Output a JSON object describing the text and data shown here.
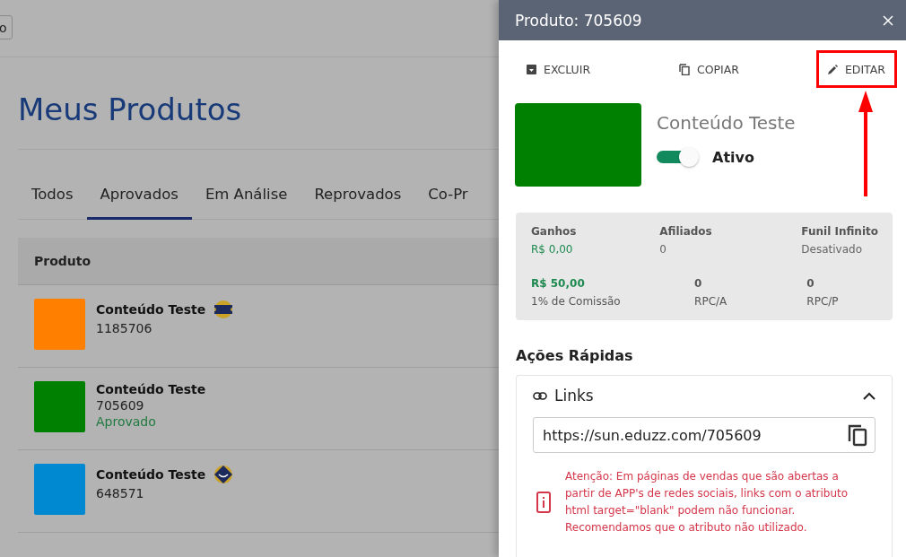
{
  "top_button": {
    "label": "o"
  },
  "page_title": "Meus Produtos",
  "tabs": [
    {
      "label": "Todos",
      "selected": false
    },
    {
      "label": "Aprovados",
      "selected": true
    },
    {
      "label": "Em Análise",
      "selected": false
    },
    {
      "label": "Reprovados",
      "selected": false
    },
    {
      "label": "Co-Pr",
      "selected": false
    }
  ],
  "table": {
    "columns": [
      "Produto"
    ],
    "rows": [
      {
        "name": "Conteúdo Teste",
        "code": "1185706",
        "color": "#ff8000",
        "kind": "ticket"
      },
      {
        "name": "Conteúdo Teste",
        "code": "705609",
        "status": "Aprovado",
        "color": "#008000",
        "kind": "plain"
      },
      {
        "name": "Conteúdo Teste",
        "code": "648571",
        "color": "#0088d0",
        "kind": "diamond"
      }
    ]
  },
  "drawer": {
    "title": "Produto: 705609",
    "actions": [
      {
        "kind": "delete",
        "label": "EXCLUIR",
        "highlighted": false
      },
      {
        "kind": "copy",
        "label": "COPIAR",
        "highlighted": false
      },
      {
        "kind": "edit",
        "label": "EDITAR",
        "highlighted": true
      }
    ],
    "product": {
      "name": "Conteúdo Teste",
      "color": "#008000",
      "active": true,
      "active_label": "Ativo"
    },
    "stats_top": [
      {
        "label": "Ganhos",
        "value": "R$ 0,00",
        "kind": "money"
      },
      {
        "label": "Afiliados",
        "value": "0",
        "kind": "plain"
      },
      {
        "label": "Funil Infinito",
        "value": "Desativado",
        "kind": "plain"
      }
    ],
    "stats_bottom": [
      {
        "value": "R$ 50,00",
        "label": "1% de Comissão",
        "kind": "money"
      },
      {
        "value": "0",
        "label": "RPC/A",
        "kind": "plain"
      },
      {
        "value": "0",
        "label": "RPC/P",
        "kind": "plain"
      }
    ],
    "quick_title": "Ações Rápidas",
    "links": {
      "title": "Links",
      "expanded": true,
      "url": "https://sun.eduzz.com/705609",
      "warning": "Atenção: Em páginas de vendas que são abertas a partir de APP's de redes sociais, links com o atributo html target=\"blank\" podem não funcionar. Recomendamos que o atributo não utilizado."
    }
  }
}
